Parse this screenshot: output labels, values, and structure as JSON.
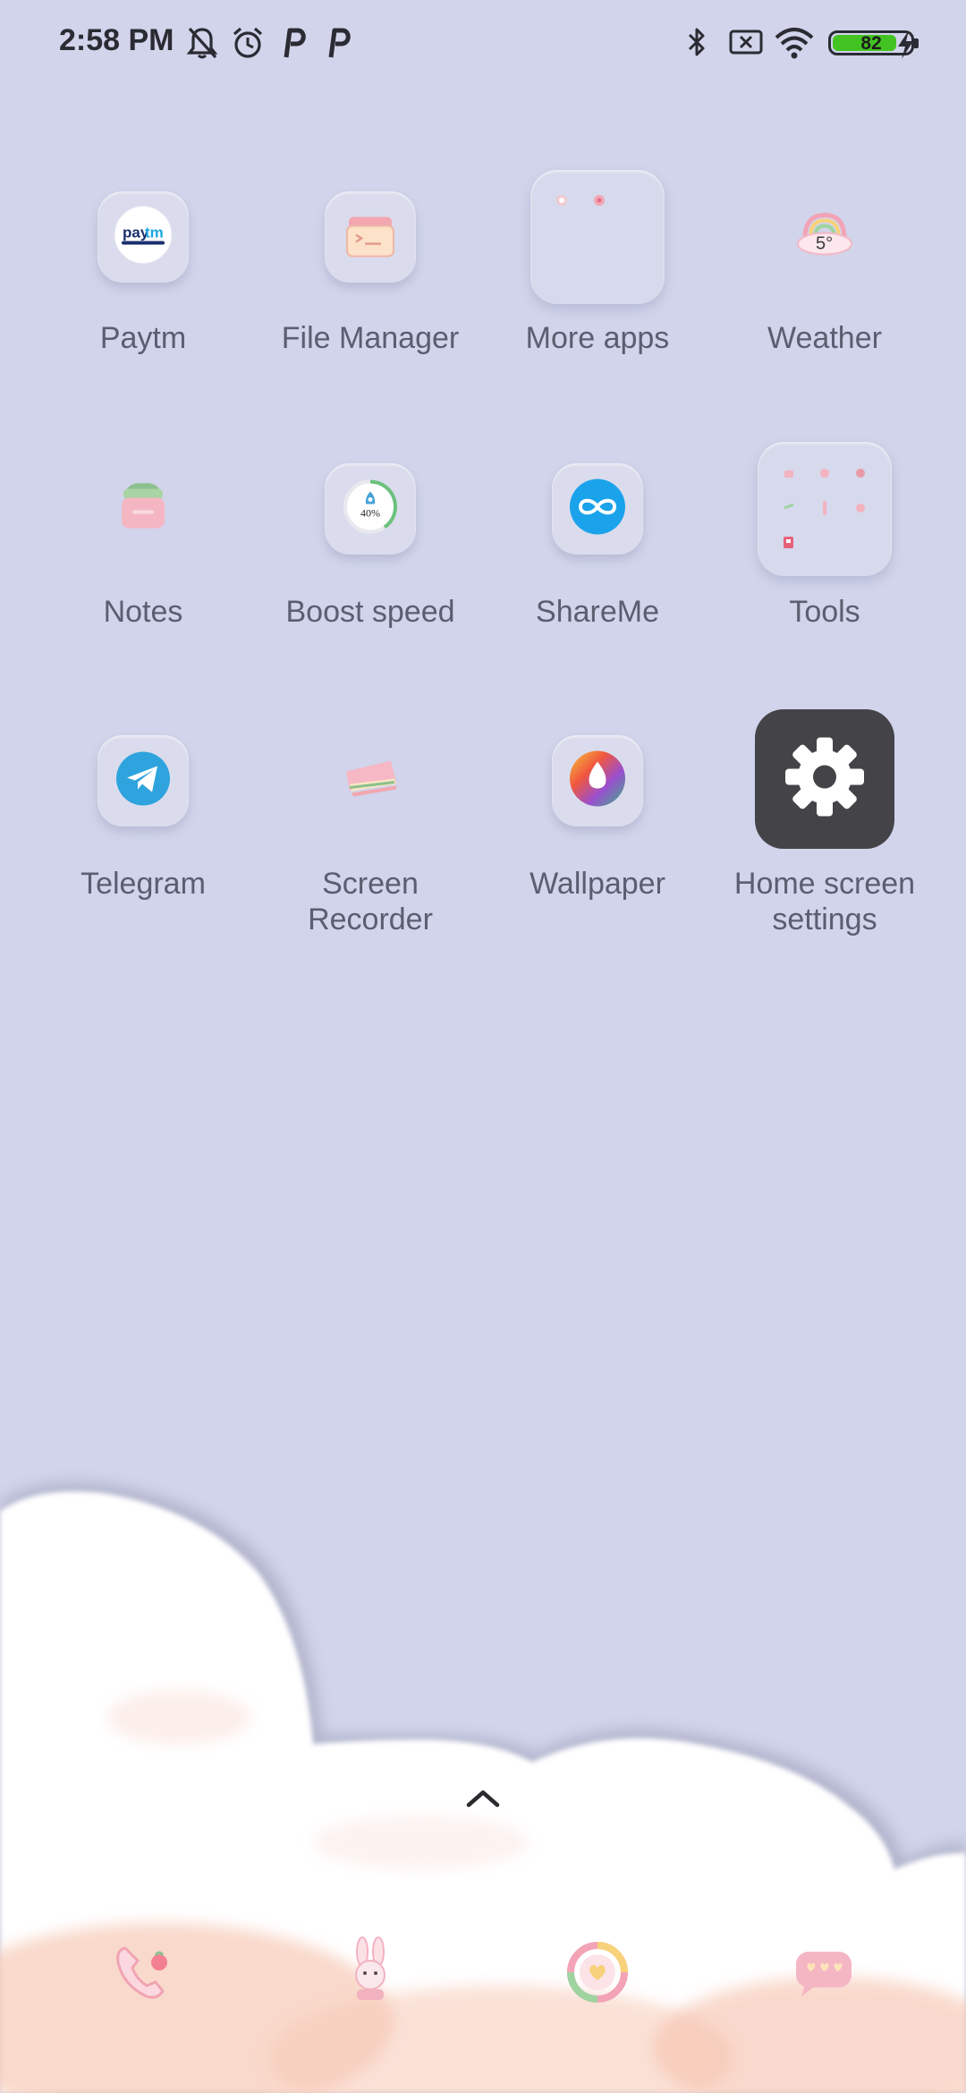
{
  "status_bar": {
    "time": "2:58 PM",
    "battery_percent": "82",
    "battery_level": 0.82,
    "icons": [
      "notifications-muted-icon",
      "alarm-icon",
      "p-icon",
      "p-icon",
      "bluetooth-icon",
      "no-sim-icon",
      "wifi-icon",
      "battery-icon",
      "charging-icon"
    ]
  },
  "apps": {
    "paytm": {
      "label": "Paytm",
      "logo_text_1": "pay",
      "logo_text_2": "tm"
    },
    "file_manager": {
      "label": "File Manager"
    },
    "more_apps": {
      "label": "More apps"
    },
    "weather": {
      "label": "Weather",
      "temp": "5°"
    },
    "notes": {
      "label": "Notes"
    },
    "boost_speed": {
      "label": "Boost speed",
      "percent": "40%"
    },
    "shareme": {
      "label": "ShareMe"
    },
    "tools": {
      "label": "Tools"
    },
    "telegram": {
      "label": "Telegram"
    },
    "screen_recorder": {
      "label_line1": "Screen",
      "label_line2": "Recorder"
    },
    "wallpaper": {
      "label": "Wallpaper"
    },
    "home_settings": {
      "label_line1": "Home screen",
      "label_line2": "settings"
    }
  },
  "dock": {
    "items": [
      "phone-icon",
      "bunny-icon",
      "camera-icon",
      "messages-icon"
    ]
  },
  "colors": {
    "background": "#d1d4ea",
    "battery_fill": "#43c321",
    "settings_tile": "#444448"
  }
}
